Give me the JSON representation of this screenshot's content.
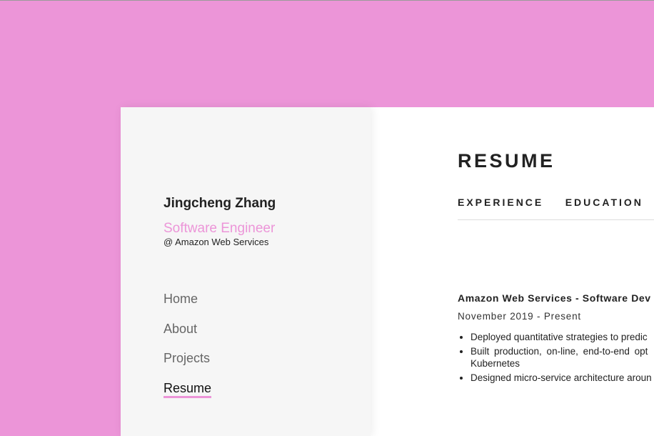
{
  "colors": {
    "accent": "#ec95d8",
    "sidebar_bg": "#f6f6f6"
  },
  "profile": {
    "name": "Jingcheng Zhang",
    "role": "Software Engineer",
    "company": "@ Amazon Web Services"
  },
  "nav": {
    "items": [
      {
        "label": "Home"
      },
      {
        "label": "About"
      },
      {
        "label": "Projects"
      },
      {
        "label": "Resume",
        "active": true
      }
    ]
  },
  "main": {
    "title": "RESUME",
    "tabs": [
      {
        "label": "EXPERIENCE"
      },
      {
        "label": "EDUCATION"
      }
    ],
    "job": {
      "heading": "Amazon Web Services  -  Software Dev",
      "dates": "November 2019 - Present",
      "bullets": [
        {
          "line1": "Deployed quantitative strategies to predic"
        },
        {
          "line1": "Built production, on-line, end-to-end opt",
          "line2": "Kubernetes"
        },
        {
          "line1": "Designed micro-service architecture aroun"
        }
      ]
    }
  }
}
